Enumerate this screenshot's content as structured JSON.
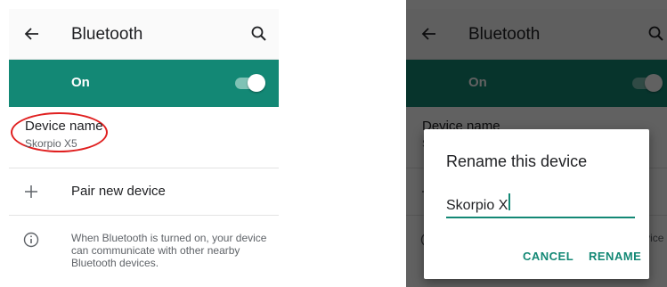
{
  "app": {
    "title": "Bluetooth",
    "switch_label": "On",
    "switch_on": true
  },
  "device_name": {
    "title": "Device name",
    "value": "Skorpio X5"
  },
  "pair": {
    "label": "Pair new device"
  },
  "info": {
    "text": "When Bluetooth is turned on, your device can communicate with other nearby Bluetooth devices."
  },
  "dialog": {
    "title": "Rename this device",
    "input_value": "Skorpio X",
    "cancel_label": "CANCEL",
    "rename_label": "RENAME"
  },
  "icons": {
    "back": "arrow-back-icon",
    "search": "search-icon",
    "plus": "plus-icon",
    "info": "info-icon"
  },
  "colors": {
    "accent": "#138875",
    "annotation": "#e02020"
  }
}
